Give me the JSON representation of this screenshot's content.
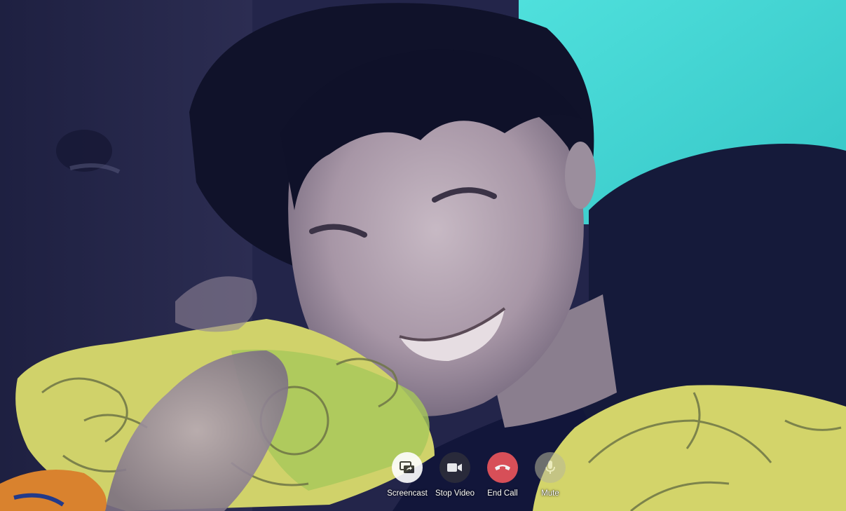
{
  "call": {
    "controls": [
      {
        "id": "screencast",
        "label": "Screencast",
        "icon": "screencast-icon",
        "bg": "#ffffff",
        "fg": "#333333",
        "opacity": 0.9
      },
      {
        "id": "stop-video",
        "label": "Stop Video",
        "icon": "video-camera-icon",
        "bg": "#2c2d3a",
        "fg": "#ffffff",
        "opacity": 0.9
      },
      {
        "id": "end-call",
        "label": "End Call",
        "icon": "phone-hangup-icon",
        "bg": "#e2535a",
        "fg": "#ffffff",
        "opacity": 0.95
      },
      {
        "id": "mute",
        "label": "Mute",
        "icon": "microphone-icon",
        "bg": "#b9b89a",
        "fg": "#ffffff",
        "opacity": 0.55
      }
    ]
  },
  "colors": {
    "wall": "#3fd6d2",
    "headboard": "#24264a",
    "hair": "#10122a",
    "skin": "#a89aa8",
    "shirt": "#151a3a",
    "pillow": "#d3d46a",
    "pillow_pattern": "#6e7546",
    "end_call": "#e2535a"
  }
}
